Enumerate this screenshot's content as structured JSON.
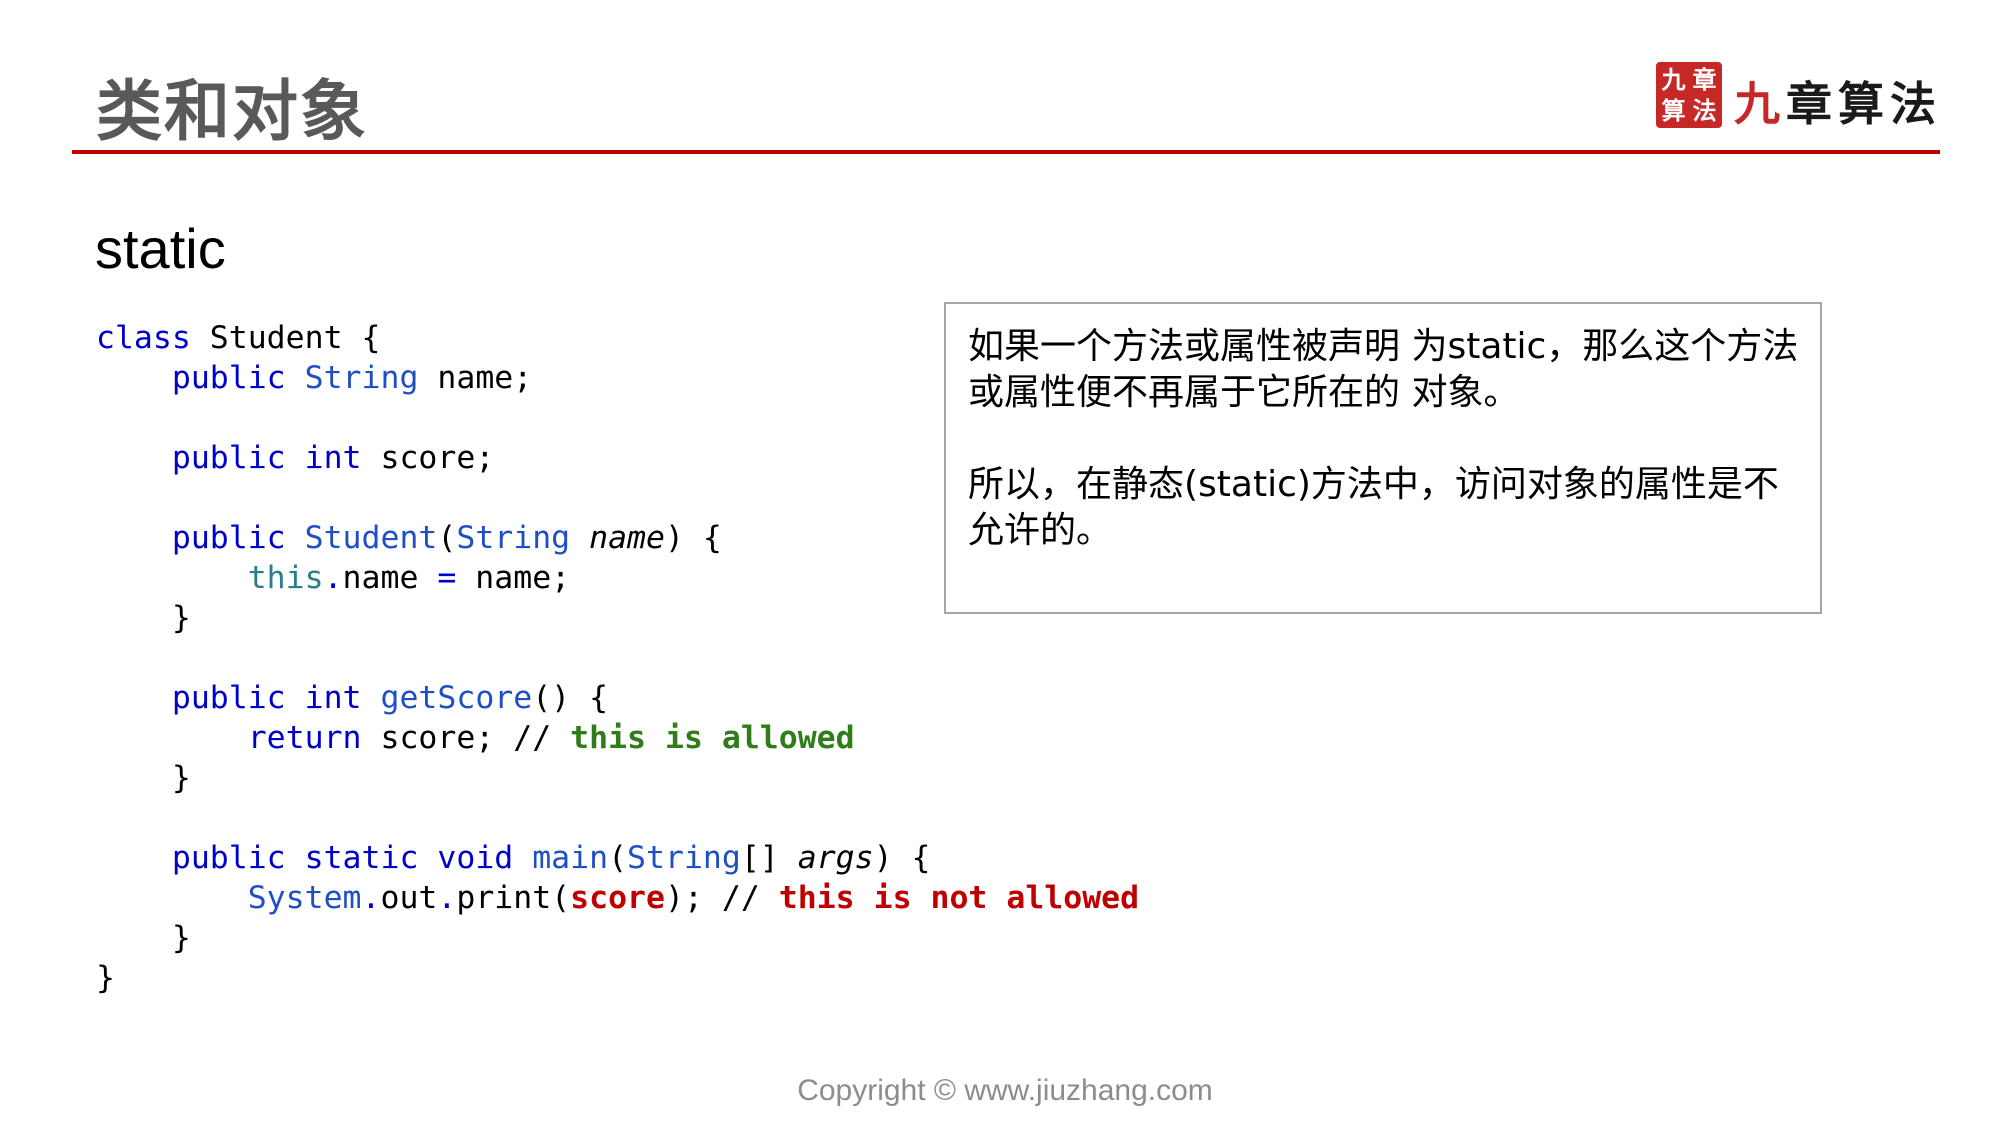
{
  "slide": {
    "title": "类和对象",
    "section_heading": "static",
    "copyright": "Copyright © www.jiuzhang.com"
  },
  "logo": {
    "seal_chars": [
      "九",
      "章",
      "算",
      "法"
    ],
    "text_first": "九",
    "text_rest": "章算法"
  },
  "code": {
    "l1": {
      "a": "class",
      "b": " Student {"
    },
    "l2": {
      "a": "public",
      "b": " ",
      "c": "String",
      "d": " name;"
    },
    "l4": {
      "a": "public",
      "b": " ",
      "c": "int",
      "d": " score;"
    },
    "l6": {
      "a": "public",
      "b": " ",
      "c": "Student",
      "d": "(",
      "e": "String",
      "f": " ",
      "g": "name",
      "h": ") {"
    },
    "l7": {
      "a": "this",
      "b": ".",
      "c": "name",
      "d": " ",
      "e": "=",
      "f": " name;"
    },
    "l8": {
      "a": "}"
    },
    "l10": {
      "a": "public",
      "b": " ",
      "c": "int",
      "d": " ",
      "e": "getScore",
      "f": "() {"
    },
    "l11": {
      "a": "return",
      "b": " score; // ",
      "c": "this is allowed"
    },
    "l12": {
      "a": "}"
    },
    "l14": {
      "a": "public",
      "b": " ",
      "c": "static",
      "d": " ",
      "e": "void",
      "f": " ",
      "g": "main",
      "h": "(",
      "i": "String",
      "j": "[] ",
      "k": "args",
      "l": ") {"
    },
    "l15": {
      "a": "System",
      "b": ".",
      "c": "out",
      "d": ".",
      "e": "print(",
      "f": "score",
      "g": "); // ",
      "h": "this is not allowed"
    },
    "l16": {
      "a": "}"
    },
    "l17": {
      "a": "}"
    }
  },
  "note": {
    "paragraph1": "如果一个方法或属性被声明 为static，那么这个方法或属性便不再属于它所在的 对象。",
    "paragraph2": "所以，在静态(static)方法中，访问对象的属性是不允许的。"
  },
  "colors": {
    "title_rule": "#c00000",
    "keyword": "#0000cc",
    "comment_allowed": "#2e7d18",
    "comment_not_allowed": "#c00000"
  }
}
